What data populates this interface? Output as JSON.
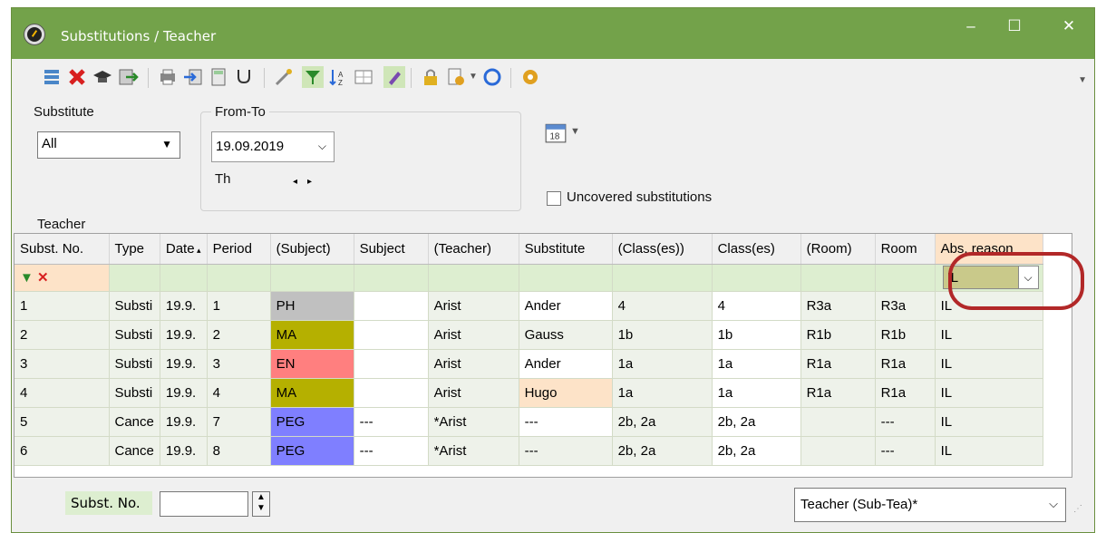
{
  "window": {
    "title": "Substitutions / Teacher",
    "minimize": "–",
    "maximize": "☐",
    "close": "✕"
  },
  "toolbar": {
    "icons": [
      "list-icon",
      "delete-icon",
      "teacher-hat-icon",
      "export-icon",
      "print-icon",
      "import-icon",
      "calculator-icon",
      "stethoscope-icon",
      "wand-icon",
      "filter-icon",
      "sort-icon",
      "grid-icon",
      "edit-icon",
      "lock-icon",
      "settings-icon",
      "refresh-icon",
      "gear-icon"
    ]
  },
  "panel": {
    "substitute_label": "Substitute",
    "substitute_value": "All",
    "fromto_label": "From-To",
    "date_value": "19.09.2019",
    "weekday": "Th",
    "uncovered_label": "Uncovered substitutions",
    "teacher_label": "Teacher"
  },
  "grid": {
    "headers": [
      "Subst. No.",
      "Type",
      "Date",
      "Period",
      "(Subject)",
      "Subject",
      "(Teacher)",
      "Substitute",
      "(Class(es))",
      "Class(es)",
      "(Room)",
      "Room",
      "Abs. reason"
    ],
    "filter_value": "IL",
    "rows": [
      {
        "no": "1",
        "type": "Substi",
        "date": "19.9.",
        "period": "1",
        "subj_orig": "PH",
        "subj_color": "#c0c0c0",
        "subj": "",
        "teacher_orig": "Arist",
        "substitute": "Ander",
        "classes_orig": "4",
        "classes": "4",
        "room_orig": "R3a",
        "room": "R3a",
        "reason": "IL",
        "sub_color": "#ffffff"
      },
      {
        "no": "2",
        "type": "Substi",
        "date": "19.9.",
        "period": "2",
        "subj_orig": "MA",
        "subj_color": "#b5b000",
        "subj": "",
        "teacher_orig": "Arist",
        "substitute": "Gauss",
        "classes_orig": "1b",
        "classes": "1b",
        "room_orig": "R1b",
        "room": "R1b",
        "reason": "IL",
        "sub_color": "#eef2ea"
      },
      {
        "no": "3",
        "type": "Substi",
        "date": "19.9.",
        "period": "3",
        "subj_orig": "EN",
        "subj_color": "#ff7f7f",
        "subj": "",
        "teacher_orig": "Arist",
        "substitute": "Ander",
        "classes_orig": "1a",
        "classes": "1a",
        "room_orig": "R1a",
        "room": "R1a",
        "reason": "IL",
        "sub_color": "#ffffff"
      },
      {
        "no": "4",
        "type": "Substi",
        "date": "19.9.",
        "period": "4",
        "subj_orig": "MA",
        "subj_color": "#b5b000",
        "subj": "",
        "teacher_orig": "Arist",
        "substitute": "Hugo",
        "classes_orig": "1a",
        "classes": "1a",
        "room_orig": "R1a",
        "room": "R1a",
        "reason": "IL",
        "sub_color": "#fde3c8"
      },
      {
        "no": "5",
        "type": "Cance",
        "date": "19.9.",
        "period": "7",
        "subj_orig": "PEG",
        "subj_color": "#7f7fff",
        "subj": "---",
        "teacher_orig": "*Arist",
        "substitute": "---",
        "classes_orig": "2b, 2a",
        "classes": "2b, 2a",
        "room_orig": "",
        "room": "---",
        "reason": "IL",
        "sub_color": "#ffffff"
      },
      {
        "no": "6",
        "type": "Cance",
        "date": "19.9.",
        "period": "8",
        "subj_orig": "PEG",
        "subj_color": "#7f7fff",
        "subj": "---",
        "teacher_orig": "*Arist",
        "substitute": "---",
        "classes_orig": "2b, 2a",
        "classes": "2b, 2a",
        "room_orig": "",
        "room": "---",
        "reason": "IL",
        "sub_color": "#eef2ea"
      }
    ]
  },
  "bottom": {
    "subst_no_label": "Subst. No.",
    "subst_no_value": "",
    "view_value": "Teacher (Sub-Tea)*"
  },
  "colors": {
    "titlebar": "#73a24a",
    "highlight": "#b22828"
  }
}
